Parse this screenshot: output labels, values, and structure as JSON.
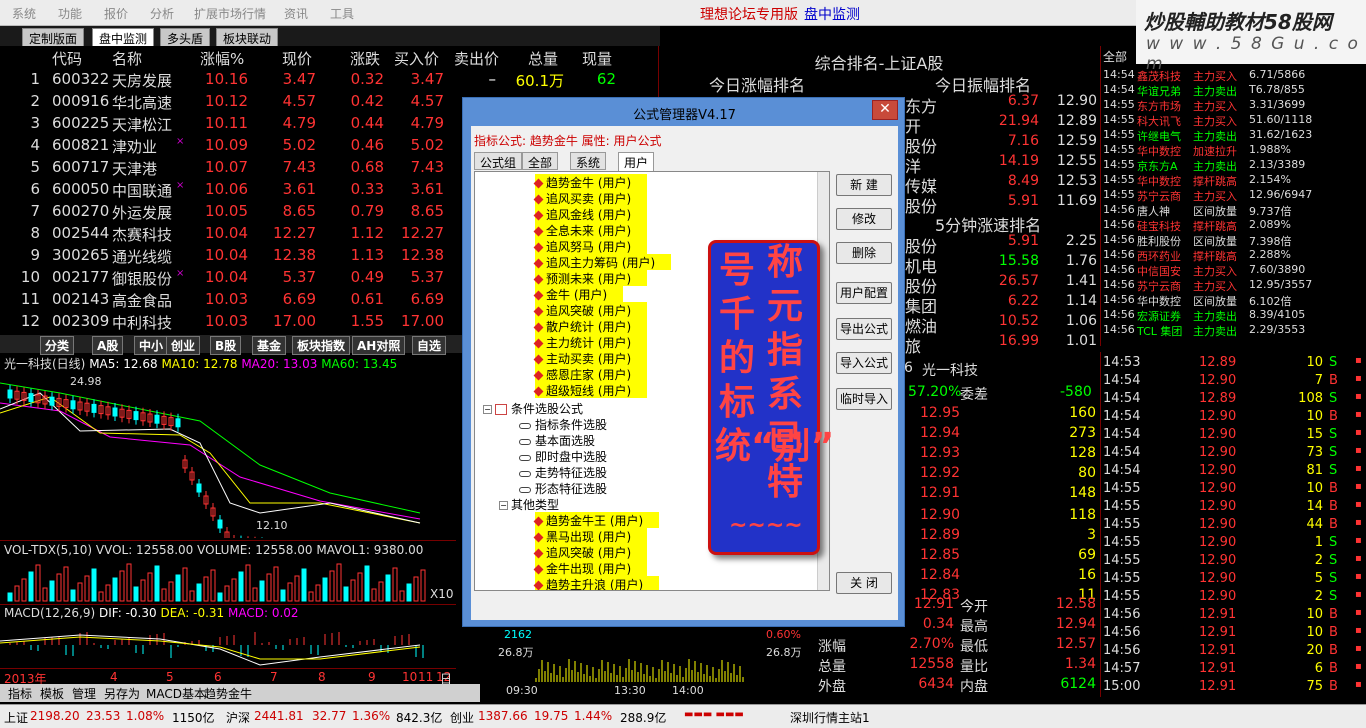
{
  "menu": {
    "items": [
      "系统",
      "功能",
      "报价",
      "分析",
      "扩展市场行情",
      "资讯",
      "工具"
    ],
    "forum_title": "理想论坛专用版",
    "monitor": "盘中监测"
  },
  "brand": {
    "line1": "炒股輔助教材58股网",
    "line2": "w w w . 5 8 G u . c o m"
  },
  "tabs": [
    "定制版面",
    "盘中监测",
    "多头盾",
    "板块联动"
  ],
  "stock_table": {
    "headers": [
      "代码",
      "名称",
      "涨幅%",
      "现价",
      "涨跌",
      "买入价",
      "卖出价",
      "总量",
      "现量"
    ],
    "rows": [
      {
        "idx": "1",
        "code": "600322",
        "name": "天房发展",
        "pct": "10.16",
        "price": "3.47",
        "chg": "0.32",
        "buy": "3.47",
        "sell": "–",
        "vol": "60.1万",
        "cur": "62"
      },
      {
        "idx": "2",
        "code": "000916",
        "name": "华北高速",
        "pct": "10.12",
        "price": "4.57",
        "chg": "0.42",
        "buy": "4.57",
        "sell": "",
        "vol": "",
        "cur": ""
      },
      {
        "idx": "3",
        "code": "600225",
        "name": "天津松江",
        "pct": "10.11",
        "price": "4.79",
        "chg": "0.44",
        "buy": "4.79",
        "sell": "",
        "vol": "",
        "cur": ""
      },
      {
        "idx": "4",
        "code": "600821",
        "name": "津劝业",
        "pct": "10.09",
        "price": "5.02",
        "chg": "0.46",
        "buy": "5.02",
        "sell": "",
        "vol": "",
        "cur": "",
        "mark": "×"
      },
      {
        "idx": "5",
        "code": "600717",
        "name": "天津港",
        "pct": "10.07",
        "price": "7.43",
        "chg": "0.68",
        "buy": "7.43",
        "sell": "",
        "vol": "",
        "cur": ""
      },
      {
        "idx": "6",
        "code": "600050",
        "name": "中国联通",
        "pct": "10.06",
        "price": "3.61",
        "chg": "0.33",
        "buy": "3.61",
        "sell": "",
        "vol": "",
        "cur": "",
        "mark": "×"
      },
      {
        "idx": "7",
        "code": "600270",
        "name": "外运发展",
        "pct": "10.05",
        "price": "8.65",
        "chg": "0.79",
        "buy": "8.65",
        "sell": "",
        "vol": "",
        "cur": ""
      },
      {
        "idx": "8",
        "code": "002544",
        "name": "杰赛科技",
        "pct": "10.04",
        "price": "12.27",
        "chg": "1.12",
        "buy": "12.27",
        "sell": "",
        "vol": "",
        "cur": ""
      },
      {
        "idx": "9",
        "code": "300265",
        "name": "通光线缆",
        "pct": "10.04",
        "price": "12.38",
        "chg": "1.13",
        "buy": "12.38",
        "sell": "",
        "vol": "",
        "cur": ""
      },
      {
        "idx": "10",
        "code": "002177",
        "name": "御银股份",
        "pct": "10.04",
        "price": "5.37",
        "chg": "0.49",
        "buy": "5.37",
        "sell": "",
        "vol": "",
        "cur": "",
        "mark": "×"
      },
      {
        "idx": "11",
        "code": "002143",
        "name": "高金食品",
        "pct": "10.03",
        "price": "6.69",
        "chg": "0.61",
        "buy": "6.69",
        "sell": "",
        "vol": "",
        "cur": ""
      },
      {
        "idx": "12",
        "code": "002309",
        "name": "中利科技",
        "pct": "10.03",
        "price": "17.00",
        "chg": "1.55",
        "buy": "17.00",
        "sell": "",
        "vol": "",
        "cur": ""
      }
    ]
  },
  "ranking": {
    "title": "综合排名-上证A股",
    "left_title": "今日涨幅排名",
    "right_title": "今日振幅排名",
    "speed_title": "5分钟涨速排名",
    "amp_rows": [
      {
        "name": "东方",
        "a": "6.37",
        "b": "12.90"
      },
      {
        "name": "开",
        "a": "21.94",
        "b": "12.89"
      },
      {
        "name": "股份",
        "a": "7.16",
        "b": "12.59"
      },
      {
        "name": "洋",
        "a": "14.19",
        "b": "12.55"
      },
      {
        "name": "传媒",
        "a": "8.49",
        "b": "12.53"
      },
      {
        "name": "股份",
        "a": "5.91",
        "b": "11.69"
      }
    ],
    "speed_rows": [
      {
        "name": "股份",
        "a": "5.91",
        "b": "2.25"
      },
      {
        "name": "机电",
        "a": "15.58",
        "b": "1.76"
      },
      {
        "name": "股份",
        "a": "26.57",
        "b": "1.41"
      },
      {
        "name": "集团",
        "a": "6.22",
        "b": "1.14"
      },
      {
        "name": "燃油",
        "a": "10.52",
        "b": "1.06"
      },
      {
        "name": "旅",
        "a": "16.99",
        "b": "1.01"
      }
    ]
  },
  "ticks": {
    "header": "全部",
    "rows": [
      {
        "t": "14:54",
        "n": "鑫茂科技",
        "a": "主力买入",
        "v": "6.71/5866",
        "c": "#f33"
      },
      {
        "t": "14:54",
        "n": "华谊兄弟",
        "a": "主力卖出",
        "v": "T6.78/855",
        "c": "#0f0"
      },
      {
        "t": "14:55",
        "n": "东方市场",
        "a": "主力买入",
        "v": "3.31/3699",
        "c": "#f33"
      },
      {
        "t": "14:55",
        "n": "科大讯飞",
        "a": "主力买入",
        "v": "51.60/1118",
        "c": "#f33"
      },
      {
        "t": "14:55",
        "n": "许继电气",
        "a": "主力卖出",
        "v": "31.62/1623",
        "c": "#0f0"
      },
      {
        "t": "14:55",
        "n": "华中数控",
        "a": "加速拉升",
        "v": "1.988%",
        "c": "#f33"
      },
      {
        "t": "14:55",
        "n": "京东方A",
        "a": "主力卖出",
        "v": "2.13/3389",
        "c": "#0f0"
      },
      {
        "t": "14:55",
        "n": "华中数控",
        "a": "撑杆跳高",
        "v": "2.154%",
        "c": "#f33"
      },
      {
        "t": "14:55",
        "n": "苏宁云商",
        "a": "主力买入",
        "v": "12.96/6947",
        "c": "#f33"
      },
      {
        "t": "14:56",
        "n": "唐人神",
        "a": "区间放量",
        "v": "9.737倍",
        "c": "#ddd"
      },
      {
        "t": "14:56",
        "n": "硅宝科技",
        "a": "撑杆跳高",
        "v": "2.089%",
        "c": "#f33"
      },
      {
        "t": "14:56",
        "n": "胜利股份",
        "a": "区间放量",
        "v": "7.398倍",
        "c": "#ddd"
      },
      {
        "t": "14:56",
        "n": "西环药业",
        "a": "撑杆跳高",
        "v": "2.288%",
        "c": "#f33"
      },
      {
        "t": "14:56",
        "n": "中信国安",
        "a": "主力买入",
        "v": "7.60/3890",
        "c": "#f33"
      },
      {
        "t": "14:56",
        "n": "苏宁云商",
        "a": "主力买入",
        "v": "12.95/3557",
        "c": "#f33"
      },
      {
        "t": "14:56",
        "n": "华中数控",
        "a": "区间放量",
        "v": "6.102倍",
        "c": "#ddd"
      },
      {
        "t": "14:56",
        "n": "宏源证券",
        "a": "主力卖出",
        "v": "8.39/4105",
        "c": "#0f0"
      },
      {
        "t": "14:56",
        "n": "TCL 集团",
        "a": "主力卖出",
        "v": "2.29/3553",
        "c": "#0f0"
      }
    ]
  },
  "deals": [
    {
      "t": "14:53",
      "p": "12.89",
      "v": "10",
      "s": "S"
    },
    {
      "t": "14:54",
      "p": "12.90",
      "v": "7",
      "s": "B"
    },
    {
      "t": "14:54",
      "p": "12.89",
      "v": "108",
      "s": "S"
    },
    {
      "t": "14:54",
      "p": "12.90",
      "v": "10",
      "s": "B"
    },
    {
      "t": "14:54",
      "p": "12.90",
      "v": "15",
      "s": "S"
    },
    {
      "t": "14:54",
      "p": "12.90",
      "v": "73",
      "s": "S"
    },
    {
      "t": "14:54",
      "p": "12.90",
      "v": "81",
      "s": "S"
    },
    {
      "t": "14:55",
      "p": "12.90",
      "v": "10",
      "s": "B"
    },
    {
      "t": "14:55",
      "p": "12.90",
      "v": "14",
      "s": "B"
    },
    {
      "t": "14:55",
      "p": "12.90",
      "v": "44",
      "s": "B"
    },
    {
      "t": "14:55",
      "p": "12.90",
      "v": "1",
      "s": "S"
    },
    {
      "t": "14:55",
      "p": "12.90",
      "v": "2",
      "s": "S"
    },
    {
      "t": "14:55",
      "p": "12.90",
      "v": "5",
      "s": "S"
    },
    {
      "t": "14:55",
      "p": "12.90",
      "v": "2",
      "s": "S"
    },
    {
      "t": "14:56",
      "p": "12.91",
      "v": "10",
      "s": "B"
    },
    {
      "t": "14:56",
      "p": "12.91",
      "v": "10",
      "s": "B"
    },
    {
      "t": "14:56",
      "p": "12.91",
      "v": "20",
      "s": "B"
    },
    {
      "t": "14:57",
      "p": "12.91",
      "v": "6",
      "s": "B"
    },
    {
      "t": "15:00",
      "p": "12.91",
      "v": "75",
      "s": "B"
    }
  ],
  "quote": {
    "stock": "光一科技",
    "stock_num": "6",
    "weibi": "57.20%",
    "weibi_label": "委差",
    "weicha": "-580",
    "ladder": [
      {
        "p": "12.95",
        "v": "160"
      },
      {
        "p": "12.94",
        "v": "273"
      },
      {
        "p": "12.93",
        "v": "128"
      },
      {
        "p": "12.92",
        "v": "80"
      },
      {
        "p": "12.91",
        "v": "148"
      },
      {
        "p": "12.90",
        "v": "118"
      },
      {
        "p": "12.89",
        "v": "3"
      },
      {
        "p": "12.85",
        "v": "69"
      },
      {
        "p": "12.84",
        "v": "16"
      },
      {
        "p": "12.83",
        "v": "11"
      }
    ],
    "stats": [
      {
        "l": "",
        "v": "12.91",
        "l2": "今开",
        "v2": "12.58"
      },
      {
        "l": "",
        "v": "0.34",
        "l2": "最高",
        "v2": "12.94"
      },
      {
        "l": "涨幅",
        "v": "2.70%",
        "l2": "最低",
        "v2": "12.57"
      },
      {
        "l": "总量",
        "v": "12558",
        "l2": "量比",
        "v2": "1.34"
      },
      {
        "l": "外盘",
        "v": "6434",
        "l2": "内盘",
        "v2": "6124"
      }
    ]
  },
  "kline": {
    "title": "光一科技(日线)",
    "ma5": "MA5: 12.68",
    "ma10": "MA10: 12.78",
    "ma20": "MA20: 13.03",
    "ma60": "MA60: 13.45",
    "high": "24.98",
    "low": "12.10"
  },
  "vol": {
    "label": "VOL-TDX(5,10)",
    "vvol": "VVOL: 12558.00",
    "volume": "VOLUME: 12558.00",
    "mavol": "MAVOL1: 9380.00",
    "x10": "X10"
  },
  "macd": {
    "label": "MACD(12,26,9)",
    "dif": "DIF: -0.30",
    "dea": "DEA: -0.31",
    "macd": "MACD: 0.02"
  },
  "xaxis": [
    "2013年",
    "4",
    "5",
    "6",
    "7",
    "8",
    "9",
    "10",
    "11",
    "12",
    "日线"
  ],
  "kline_tabs": [
    "分类",
    "A股",
    "中小",
    "创业",
    "B股",
    "基金",
    "板块指数",
    "AH对照",
    "自选"
  ],
  "bottom_tabs": [
    "指标",
    "模板",
    "管理",
    "另存为",
    "MACD基本",
    "趋势金牛"
  ],
  "minichart": {
    "vol": "2162",
    "amount": "26.8万",
    "pct": "0.60%",
    "amount2": "26.8万",
    "times": [
      "09:30",
      "13:30",
      "14:00"
    ]
  },
  "status": {
    "sh": "上证",
    "sh_v": "2198.20",
    "sh_c": "23.53",
    "sh_p": "1.08%",
    "sh_a": "1150亿",
    "sz": "沪深",
    "sz_v": "2441.81",
    "sz_c": "32.77",
    "sz_p": "1.36%",
    "sz_a": "842.3亿",
    "cy": "创业",
    "cy_v": "1387.66",
    "cy_c": "19.75",
    "cy_p": "1.44%",
    "cy_a": "288.9亿",
    "server": "深圳行情主站1"
  },
  "dialog": {
    "title": "公式管理器V4.17",
    "info": "指标公式: 趋势金牛  属性: 用户公式",
    "tabs": [
      "公式组",
      "全部",
      "系统",
      "用户"
    ],
    "user_items": [
      "趋势金牛   (用户)",
      "追风买卖   (用户)",
      "追风金线  (用户)",
      "全息未来   (用户)",
      "追风努马   (用户)",
      "追风主力筹码   (用户)",
      "预测未来   (用户)",
      "金牛    (用户)",
      "追风突破   (用户)",
      "散户统计   (用户)",
      "主力统计   (用户)",
      "主动买卖   (用户)",
      "感恩庄家   (用户)",
      "超级短线   (用户)"
    ],
    "cond_group": "条件选股公式",
    "cond_items": [
      "指标条件选股",
      "基本面选股",
      "即时盘中选股",
      "走势特征选股",
      "形态特征选股"
    ],
    "other_group": "其他类型",
    "other_items": [
      "趋势金牛王   (用户)",
      "黑马出现   (用户)",
      "追风突破   (用户)",
      "金牛出现   (用户)",
      "趋势主升浪   (用户)"
    ],
    "buttons": [
      "新 建",
      "修改",
      "删除",
      "用户配置",
      "导出公式",
      "导入公式",
      "临时导入",
      "关 闭"
    ]
  },
  "callout": {
    "col1": "号千的标统“别”",
    "col2": "称元指系已特",
    "tilde": "~~~~"
  }
}
